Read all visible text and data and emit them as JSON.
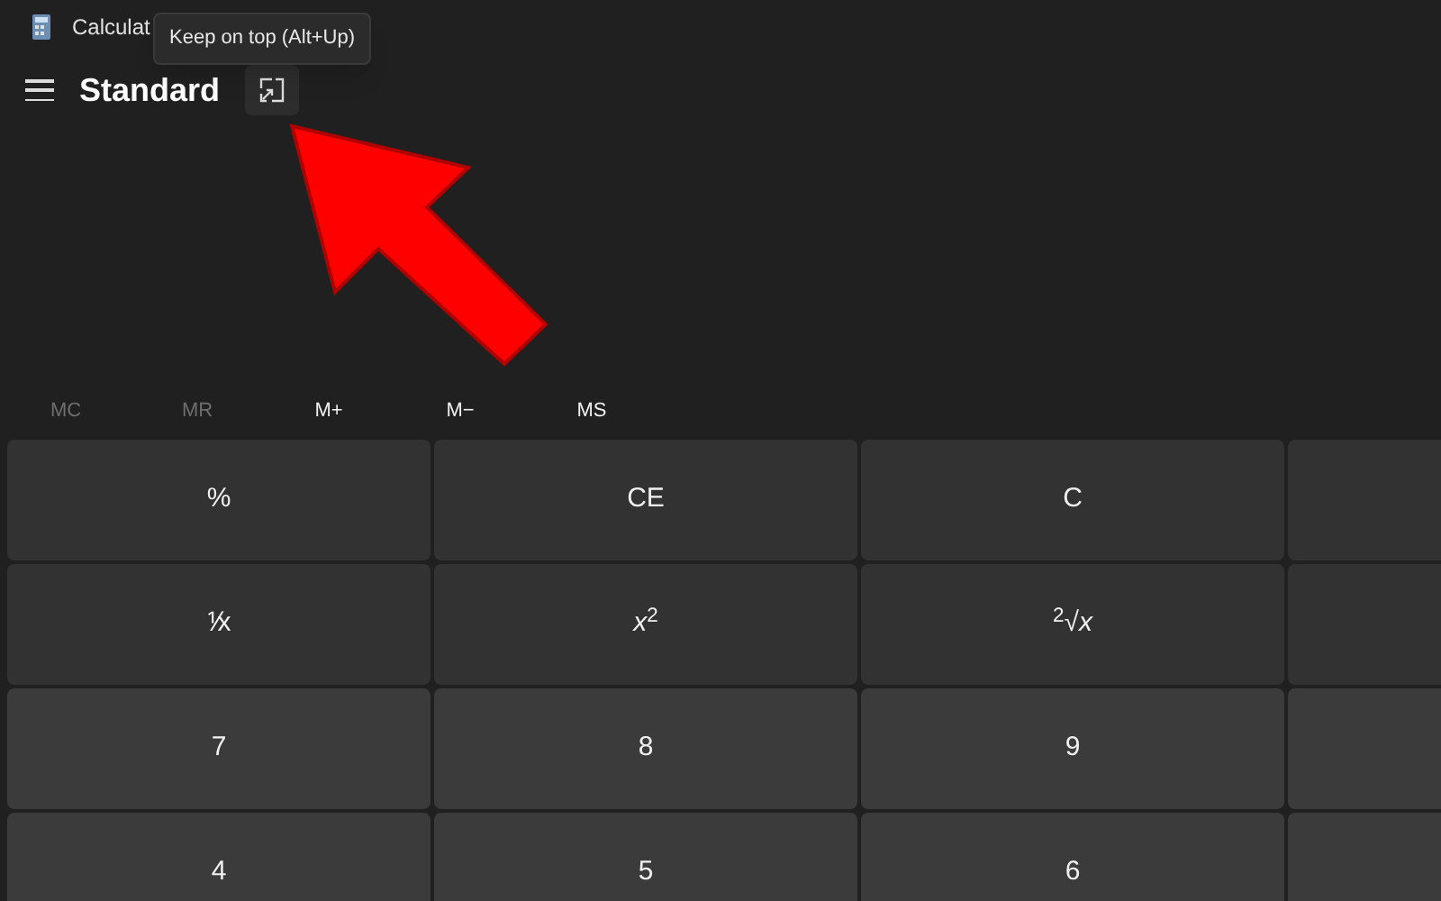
{
  "window": {
    "title": "Calculat"
  },
  "tooltip": {
    "text": "Keep on top (Alt+Up)"
  },
  "header": {
    "mode": "Standard"
  },
  "memory": [
    {
      "label": "MC",
      "disabled": true
    },
    {
      "label": "MR",
      "disabled": true
    },
    {
      "label": "M+",
      "disabled": false
    },
    {
      "label": "M−",
      "disabled": false
    },
    {
      "label": "MS",
      "disabled": false
    }
  ],
  "keypad": [
    {
      "kind": "function",
      "keys": [
        "%",
        "CE",
        "C"
      ]
    },
    {
      "kind": "function",
      "keys": [
        "⅟x",
        "*x*$^{2}$",
        "$^{2}$√*x*"
      ]
    },
    {
      "kind": "number",
      "keys": [
        "7",
        "8",
        "9"
      ]
    },
    {
      "kind": "number",
      "keys": [
        "4",
        "5",
        "6"
      ]
    }
  ]
}
